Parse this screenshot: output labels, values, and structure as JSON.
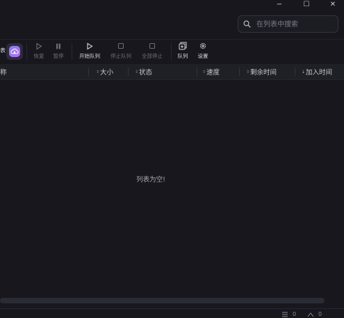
{
  "window": {
    "minimize": "−",
    "maximize": "☐",
    "close": "✕"
  },
  "search": {
    "placeholder": "在列表中搜索"
  },
  "toolbar": {
    "partial_label": "表",
    "resume": "恢复",
    "pause": "暂停",
    "start_queue": "开始队列",
    "stop_queue": "停止队列",
    "stop_all": "全部停止",
    "queue": "队列",
    "settings": "设置"
  },
  "columns": {
    "name_partial": "称",
    "size": "大小",
    "status": "状态",
    "speed": "速度",
    "remaining": "剩余时间",
    "added": "加入时间"
  },
  "empty_message": "列表为空!",
  "statusbar": {
    "down_count": "0",
    "up_count": "0"
  },
  "colors": {
    "background": "#17171d",
    "accent": "#7c6cf0"
  }
}
